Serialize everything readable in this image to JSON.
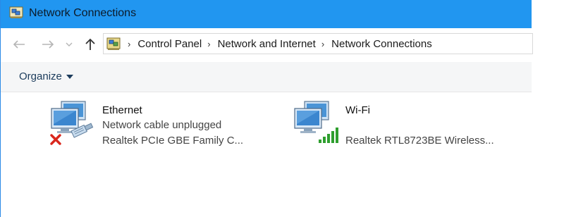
{
  "window": {
    "title": "Network Connections"
  },
  "navigation": {
    "back_icon": "back-arrow-icon",
    "forward_icon": "forward-arrow-icon",
    "recent_icon": "chevron-down-icon",
    "up_icon": "up-arrow-icon"
  },
  "address_bar": {
    "separator": "›",
    "crumbs": [
      "Control Panel",
      "Network and Internet",
      "Network Connections"
    ]
  },
  "toolbar": {
    "organize_label": "Organize"
  },
  "connections": [
    {
      "name": "Ethernet",
      "status": "Network cable unplugged",
      "adapter": "Realtek PCIe GBE Family C...",
      "icon": "ethernet-disconnected-icon",
      "status_color": "#d9261c"
    },
    {
      "name": "Wi-Fi",
      "status": "",
      "adapter": "Realtek RTL8723BE Wireless...",
      "icon": "wifi-signal-icon",
      "status_color": "#2e9e2e"
    }
  ],
  "colors": {
    "titlebar": "#2196f0",
    "toolbar_bg": "#f5f6f7"
  }
}
